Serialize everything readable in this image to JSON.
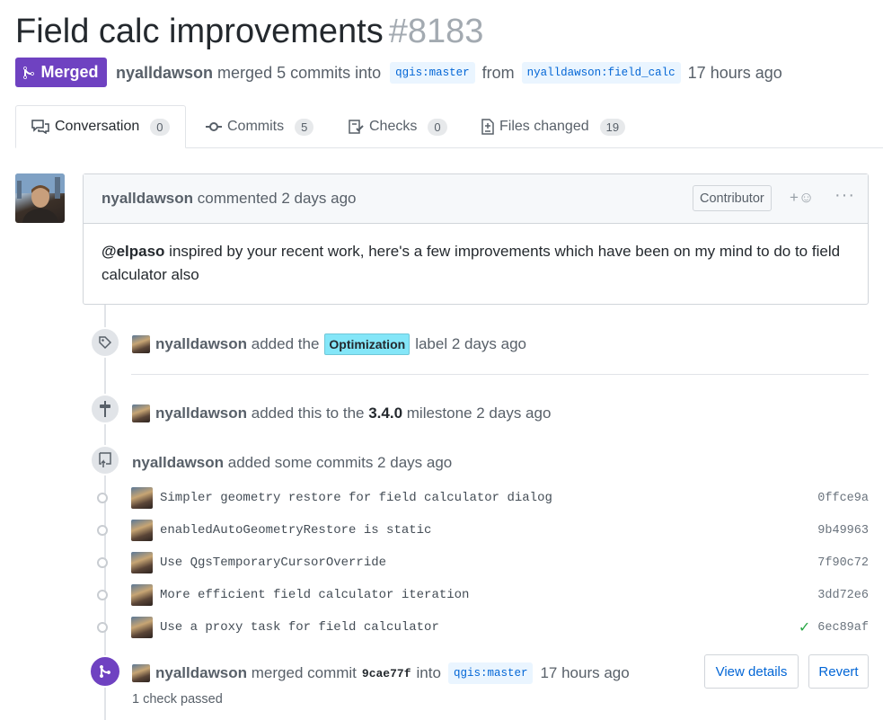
{
  "pr": {
    "title": "Field calc improvements",
    "number": "#8183",
    "state_label": "Merged",
    "author": "nyalldawson",
    "merge_text": "merged 5 commits into",
    "base_branch": "qgis:master",
    "from_text": "from",
    "head_branch": "nyalldawson:field_calc",
    "time_ago": "17 hours ago"
  },
  "tabs": [
    {
      "label": "Conversation",
      "count": "0",
      "icon": "comment-discussion-icon"
    },
    {
      "label": "Commits",
      "count": "5",
      "icon": "git-commit-icon"
    },
    {
      "label": "Checks",
      "count": "0",
      "icon": "checklist-icon"
    },
    {
      "label": "Files changed",
      "count": "19",
      "icon": "file-diff-icon"
    }
  ],
  "comment": {
    "author": "nyalldawson",
    "action": "commented",
    "time": "2 days ago",
    "role_badge": "Contributor",
    "reaction_icon": "+☺",
    "more_icon": "···",
    "mention": "@elpaso",
    "body": " inspired by your recent work, here's a few improvements which have been on my mind to do to field calculator also"
  },
  "events": {
    "label_event": {
      "author": "nyalldawson",
      "pre": "added the",
      "label": "Optimization",
      "post": "label 2 days ago",
      "label_color": "#84e6f8"
    },
    "milestone_event": {
      "author": "nyalldawson",
      "pre": "added this to the",
      "milestone": "3.4.0",
      "post": "milestone 2 days ago"
    },
    "commits_event": {
      "author": "nyalldawson",
      "text": "added some commits 2 days ago"
    },
    "merge_event": {
      "author": "nyalldawson",
      "pre": "merged commit",
      "sha": "9cae77f",
      "mid": "into",
      "branch": "qgis:master",
      "time": "17 hours ago",
      "view_details": "View details",
      "revert": "Revert",
      "checks": "1 check passed"
    }
  },
  "commits": [
    {
      "message": "Simpler geometry restore for field calculator dialog",
      "sha": "0ffce9a",
      "status": ""
    },
    {
      "message": "enabledAutoGeometryRestore is static",
      "sha": "9b49963",
      "status": ""
    },
    {
      "message": "Use QgsTemporaryCursorOverride",
      "sha": "7f90c72",
      "status": ""
    },
    {
      "message": "More efficient field calculator iteration",
      "sha": "3dd72e6",
      "status": ""
    },
    {
      "message": "Use a proxy task for field calculator",
      "sha": "6ec89af",
      "status": "✓"
    }
  ],
  "colors": {
    "merged": "#6f42c1",
    "link": "#0366d6",
    "success": "#28a745"
  }
}
